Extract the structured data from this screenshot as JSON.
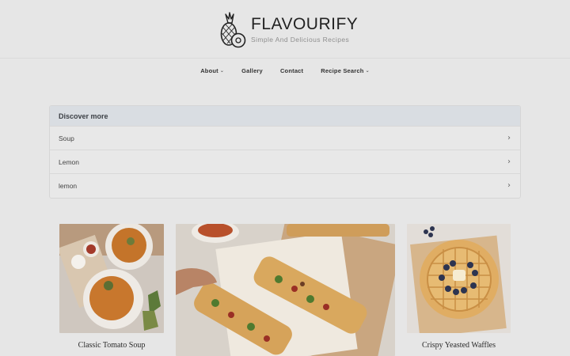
{
  "site": {
    "title": "FLAVOURIFY",
    "tagline": "Simple And Delicious Recipes"
  },
  "nav": {
    "items": [
      {
        "label": "About",
        "has_dropdown": true
      },
      {
        "label": "Gallery",
        "has_dropdown": false
      },
      {
        "label": "Contact",
        "has_dropdown": false
      },
      {
        "label": "Recipe Search",
        "has_dropdown": true
      }
    ],
    "caret_icon": "chevron-down-icon"
  },
  "discover": {
    "heading": "Discover more",
    "items": [
      {
        "label": "Soup"
      },
      {
        "label": "Lemon"
      },
      {
        "label": "lemon"
      }
    ],
    "item_icon": "chevron-right-icon"
  },
  "recipes": [
    {
      "title": "Classic Tomato Soup"
    },
    {
      "title": ""
    },
    {
      "title": "Crispy Yeasted Waffles"
    }
  ],
  "colors": {
    "page_bg": "#e6e6e6",
    "discover_header_bg": "#d9dde2",
    "text_dark": "#222222"
  }
}
